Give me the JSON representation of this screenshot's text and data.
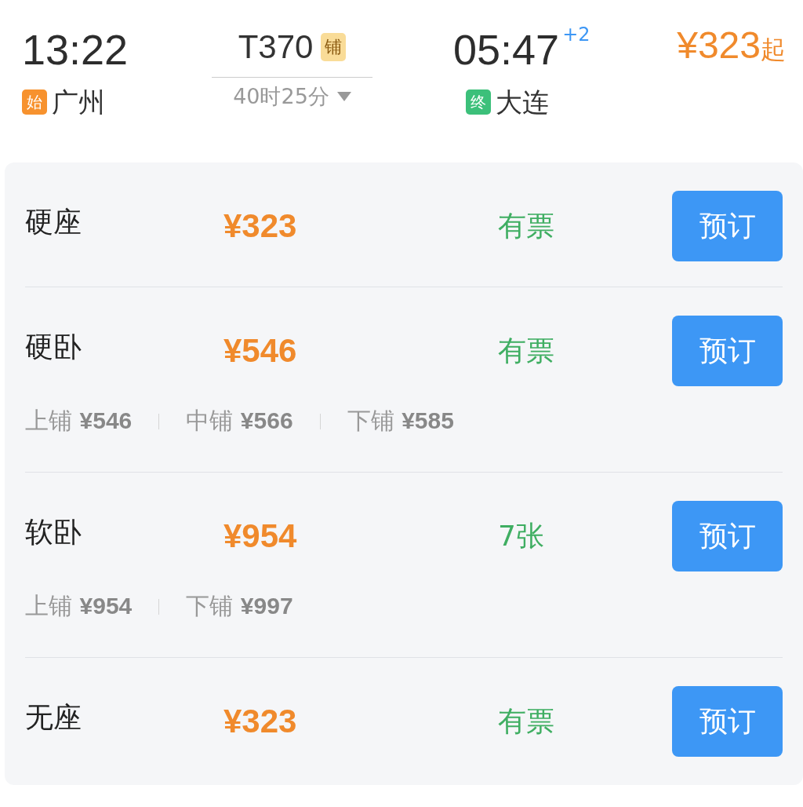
{
  "trip": {
    "depart_time": "13:22",
    "depart_tag": "始",
    "depart_station": "广州",
    "train": "T370",
    "train_tag": "铺",
    "duration": "40时25分",
    "arrive_time": "05:47",
    "day_offset": "+2",
    "arrive_tag": "终",
    "arrive_station": "大连",
    "price": "¥323",
    "price_suffix": "起"
  },
  "seats": [
    {
      "name": "硬座",
      "price": "¥323",
      "availability": "有票",
      "button": "预订"
    },
    {
      "name": "硬卧",
      "price": "¥546",
      "availability": "有票",
      "button": "预订",
      "berths": [
        {
          "label": "上铺",
          "price": "¥546"
        },
        {
          "label": "中铺",
          "price": "¥566"
        },
        {
          "label": "下铺",
          "price": "¥585"
        }
      ]
    },
    {
      "name": "软卧",
      "price": "¥954",
      "availability": "7张",
      "button": "预订",
      "berths": [
        {
          "label": "上铺",
          "price": "¥954"
        },
        {
          "label": "下铺",
          "price": "¥997"
        }
      ]
    },
    {
      "name": "无座",
      "price": "¥323",
      "availability": "有票",
      "button": "预订"
    }
  ]
}
